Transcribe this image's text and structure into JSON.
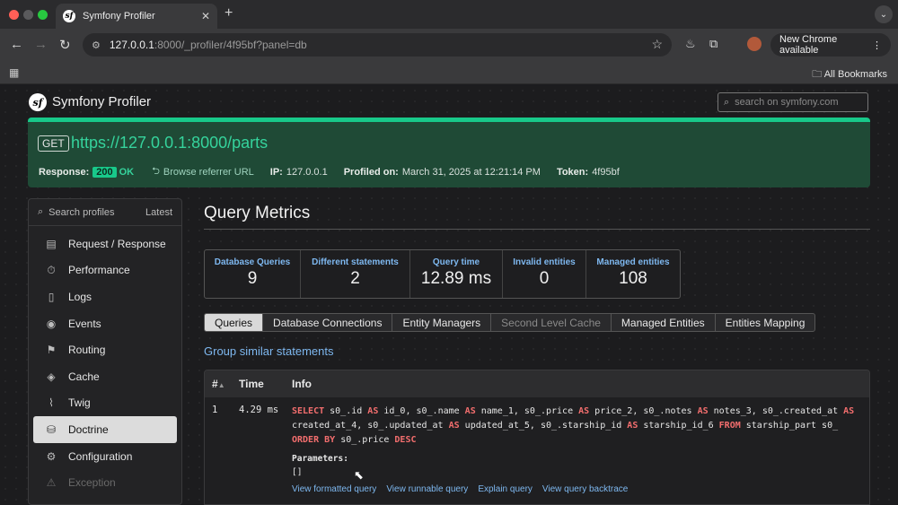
{
  "browser": {
    "tab_title": "Symfony Profiler",
    "url_host": "127.0.0.1",
    "url_path": ":8000/_profiler/4f95bf?panel=db",
    "update_label": "New Chrome available",
    "bookmarks_label": "All Bookmarks"
  },
  "header": {
    "title": "Symfony Profiler",
    "search_placeholder": "search on symfony.com"
  },
  "summary": {
    "method": "GET",
    "url": "https://127.0.0.1:8000/parts",
    "response_label": "Response:",
    "status_code": "200",
    "status_text": "OK",
    "referrer_label": "Browse referrer URL",
    "ip_label": "IP:",
    "ip": "127.0.0.1",
    "profiled_label": "Profiled on:",
    "profiled_on": "March 31, 2025 at 12:21:14 PM",
    "token_label": "Token:",
    "token": "4f95bf"
  },
  "sidebar": {
    "search_label": "Search profiles",
    "latest_label": "Latest",
    "items": [
      {
        "label": "Request / Response",
        "icon": "request-icon"
      },
      {
        "label": "Performance",
        "icon": "performance-icon"
      },
      {
        "label": "Logs",
        "icon": "logs-icon"
      },
      {
        "label": "Events",
        "icon": "events-icon"
      },
      {
        "label": "Routing",
        "icon": "routing-icon"
      },
      {
        "label": "Cache",
        "icon": "cache-icon"
      },
      {
        "label": "Twig",
        "icon": "twig-icon"
      },
      {
        "label": "Doctrine",
        "icon": "database-icon",
        "active": true
      },
      {
        "label": "Configuration",
        "icon": "configuration-icon"
      },
      {
        "label": "Exception",
        "icon": "exception-icon",
        "disabled": true
      }
    ]
  },
  "main": {
    "title": "Query Metrics",
    "metrics": [
      {
        "label": "Database Queries",
        "value": "9"
      },
      {
        "label": "Different statements",
        "value": "2"
      },
      {
        "label": "Query time",
        "value": "12.89 ms"
      },
      {
        "label": "Invalid entities",
        "value": "0"
      },
      {
        "label": "Managed entities",
        "value": "108"
      }
    ],
    "tabs": [
      {
        "label": "Queries",
        "active": true
      },
      {
        "label": "Database Connections"
      },
      {
        "label": "Entity Managers"
      },
      {
        "label": "Second Level Cache",
        "disabled": true
      },
      {
        "label": "Managed Entities"
      },
      {
        "label": "Entities Mapping"
      }
    ],
    "group_link": "Group similar statements",
    "table": {
      "col_num": "#",
      "col_time": "Time",
      "col_info": "Info"
    },
    "query": {
      "num": "1",
      "time": "4.29 ms",
      "sql_tokens": [
        {
          "kw": "SELECT"
        },
        {
          "t": " s0_.id "
        },
        {
          "kw": "AS"
        },
        {
          "t": " id_0, s0_.name "
        },
        {
          "kw": "AS"
        },
        {
          "t": " name_1, s0_.price "
        },
        {
          "kw": "AS"
        },
        {
          "t": " price_2, s0_.notes "
        },
        {
          "kw": "AS"
        },
        {
          "t": " notes_3, s0_.created_at "
        },
        {
          "kw": "AS"
        },
        {
          "t": " created_at_4, s0_.updated_at "
        },
        {
          "kw": "AS"
        },
        {
          "t": " updated_at_5, s0_.starship_id "
        },
        {
          "kw": "AS"
        },
        {
          "t": " starship_id_6 "
        },
        {
          "kw": "FROM"
        },
        {
          "t": " starship_part s0_ "
        },
        {
          "kw": "ORDER BY"
        },
        {
          "t": " s0_.price "
        },
        {
          "kw": "DESC"
        }
      ],
      "params_label": "Parameters:",
      "params_value": "[]",
      "links": [
        "View formatted query",
        "View runnable query",
        "Explain query",
        "View query backtrace"
      ]
    }
  }
}
